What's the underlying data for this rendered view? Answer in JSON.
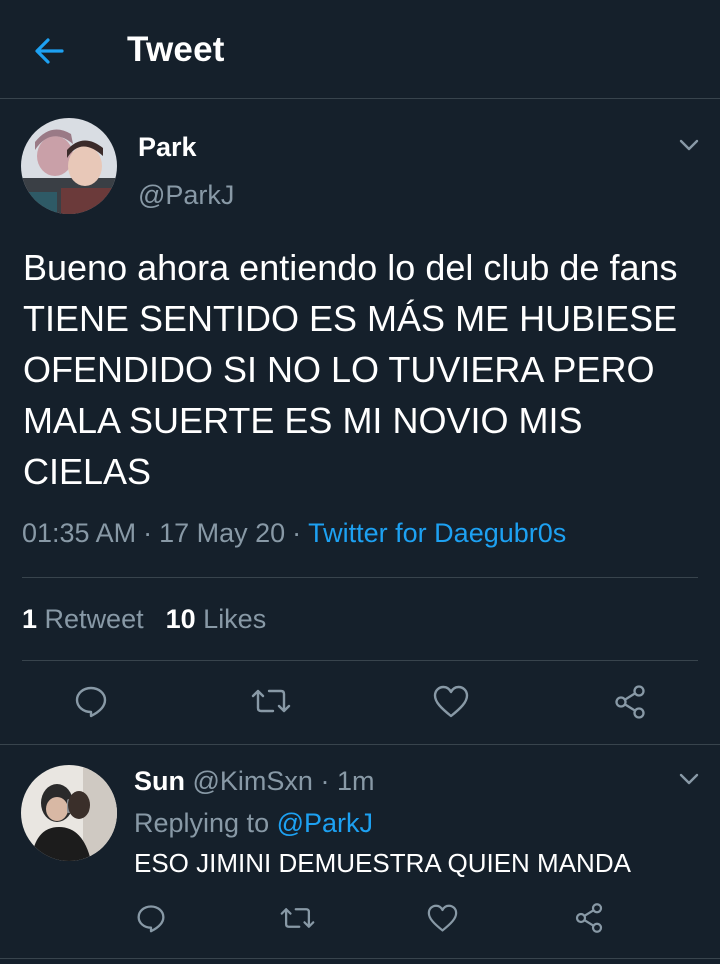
{
  "header": {
    "title": "Tweet"
  },
  "tweet": {
    "author_name": "Park",
    "author_handle": "@ParkJ",
    "text": "Bueno ahora entiendo lo del club de fans TIENE SENTIDO ES MÁS ME HUBIESE OFENDIDO SI NO LO TUVIERA PERO MALA SUERTE ES MI NOVIO MIS CIELAS",
    "time": "01:35 AM",
    "date": "17 May 20",
    "separator": "·",
    "source": "Twitter for Daegubr0s",
    "retweets_count": "1",
    "retweets_label": "Retweet",
    "likes_count": "10",
    "likes_label": "Likes"
  },
  "reply": {
    "author_name": "Sun",
    "author_handle": "@KimSxn",
    "separator": "·",
    "time_ago": "1m",
    "replying_to_label": "Replying to",
    "replying_to_handle": "@ParkJ",
    "text": "ESO JIMINI DEMUESTRA QUIEN MANDA"
  },
  "icons": {
    "back": "arrow-left-icon",
    "menu": "chevron-down-icon",
    "reply": "comment-icon",
    "retweet": "retweet-icon",
    "like": "heart-icon",
    "share": "share-icon"
  },
  "colors": {
    "background": "#15202b",
    "accent": "#1da1f2",
    "secondary_text": "#8899a6",
    "divider": "#38444d"
  }
}
